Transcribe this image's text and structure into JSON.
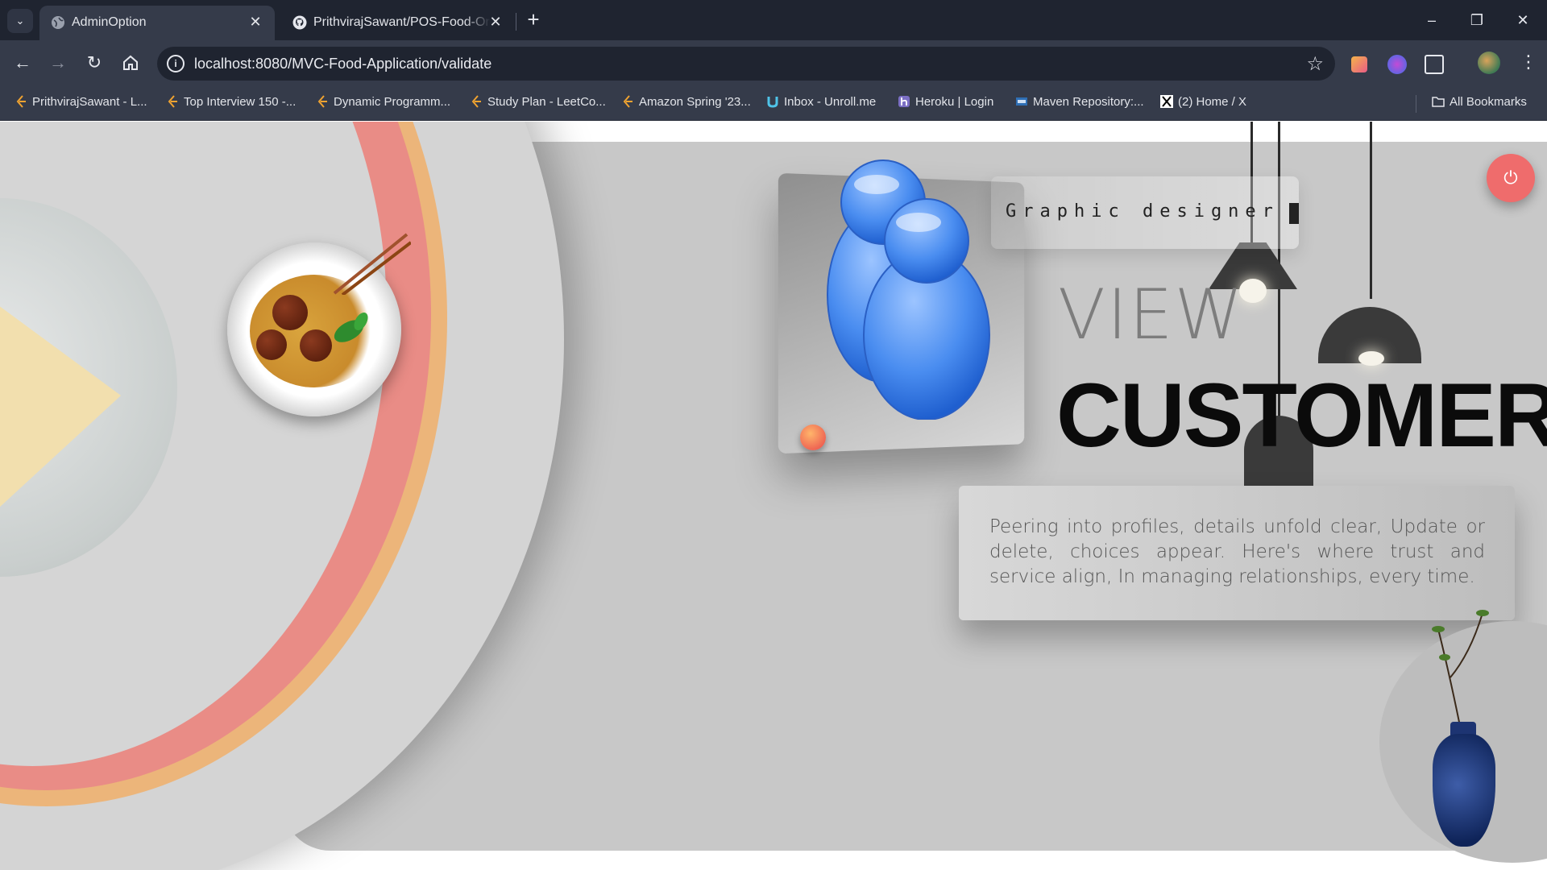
{
  "browser": {
    "tabs": [
      {
        "title": "AdminOption",
        "active": true
      },
      {
        "title": "PrithvirajSawant/POS-Food-Orc",
        "active": false
      }
    ],
    "url": "localhost:8080/MVC-Food-Application/validate",
    "bookmarks": [
      {
        "label": "PrithvirajSawant - L...",
        "icon": "leetcode-icon"
      },
      {
        "label": "Top Interview 150 -...",
        "icon": "leetcode-icon"
      },
      {
        "label": "Dynamic Programm...",
        "icon": "leetcode-icon"
      },
      {
        "label": "Study Plan - LeetCo...",
        "icon": "leetcode-icon"
      },
      {
        "label": "Amazon Spring '23...",
        "icon": "leetcode-icon"
      },
      {
        "label": "Inbox - Unroll.me",
        "icon": "unroll-icon"
      },
      {
        "label": "Heroku | Login",
        "icon": "heroku-icon"
      },
      {
        "label": "Maven Repository:...",
        "icon": "maven-icon"
      },
      {
        "label": "(2) Home / X",
        "icon": "x-icon"
      }
    ],
    "all_bookmarks": "All Bookmarks"
  },
  "page": {
    "typing_text": "Graphic designer",
    "view_label": "VIEW",
    "customers_label": "CUSTOMERS",
    "description": "Peering into profiles, details unfold clear, Update or delete, choices appear. Here's where trust and service align, In managing relationships, every time.",
    "power_icon": "power-icon",
    "accent_color": "#ef6c6c"
  }
}
